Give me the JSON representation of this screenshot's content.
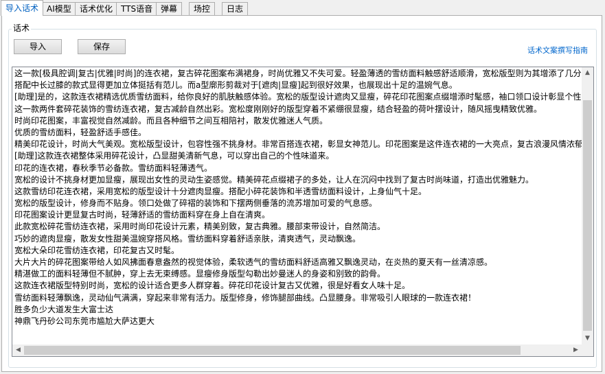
{
  "tabs": [
    {
      "label": "导入话术",
      "active": true
    },
    {
      "label": "AI模型"
    },
    {
      "label": "话术优化"
    },
    {
      "label": "TTS语音"
    },
    {
      "label": "弹幕"
    },
    {
      "label": "场控"
    },
    {
      "label": "日志"
    }
  ],
  "group": {
    "title": "话术"
  },
  "toolbar": {
    "import_label": "导入",
    "save_label": "保存",
    "guide_link": "话术文案撰写指南"
  },
  "script_lines": [
    "这一款[极具腔调|复古|优雅|时尚]的连衣裙，复古碎花图案布满裙身，时尚优雅又不失可爱。轻盈薄透的雪纺面料触感舒适顺滑，宽松版型则为其增添了几分",
    "搭配中长过膝的款式显得更加立体挺括有范儿。而a型廓形剪裁对于[遮肉|显瘦]起到很好效果，也展现出十足的温婉气息。",
    "[助理]是的，这款连衣裙精选优质雪纺面料，给你良好的肌肤触感体验。宽松的版型设计遮肉又显瘦，碎花印花图案点缀增添时髦感，袖口领口设计彰显个性",
    "这一款两件套碎花装饰的雪纺连衣裙，复古减龄自然出彩。宽松度刚刚好的版型穿着不紧绷很显瘦，结合轻盈的荷叶摆设计，随风摇曳精致优雅。",
    "时尚印花图案，丰富视觉自然减龄。而且各种细节之间互相陪衬，散发优雅迷人气质。",
    "优质的雪纺面料，轻盈舒适手感佳。",
    "精美印花设计，时尚大气美观。宽松版型设计，包容性强不挑身材。非常百搭连衣裙，彰显女神范儿。印花图案是这件连衣裙的一大亮点，复古浪漫风情浓郁",
    "[助理]这款连衣裙整体采用碎花设计，凸显甜美清新气息，可以穿出自己的个性味道来。",
    "印花的连衣裙，春秋季节必备款。雪纺面料轻薄透气。",
    "宽松的设计不挑身材更加显瘦，展现出女性的灵动生姿感觉。精美碎花点缀裙子的多处，让人在沉闷中找到了复古时尚味道，打造出优雅魅力。",
    "这款雪纺印花连衣裙，采用宽松的版型设计十分遮肉显瘦。搭配小碎花装饰和半透雪纺面料设计，上身仙气十足。",
    "宽松的版型设计，修身而不贴身。领口处做了碎褶的装饰和下摆两侧垂落的流苏增加可爱的气息感。",
    "印花图案设计更显复古时尚，轻薄舒适的雪纺面料穿在身上自在清爽。",
    "此款宽松碎花雪纺连衣裙，采用时尚印花设计元素，精美别致，复古典雅。腰部束带设计，自然简洁。",
    "巧妙的遮肉显瘦，散发女性甜美温婉穿搭风格。雪纺面料穿着舒适亲肤，清爽透气，灵动飘逸。",
    "宽松大朵印花雪纺连衣裙，印花复古又时髦。",
    "大片大片的碎花图案带给人如风拂面春意盎然的视觉体验，柔软透气的雪纺面料舒适高雅又飘逸灵动，在炎热的夏天有一丝清凉感。",
    "精湛做工的面料轻薄但不腻肿，穿上去无束缚感。显瘦修身版型勾勒出妙曼迷人的身姿和别致的韵骨。",
    "这款连衣裙版型特别时尚，宽松的设计适合更多人群穿着。碎花印花设计复古又优雅，很是好看女人味十足。",
    "雪纺面料轻薄飘逸，灵动仙气满满，穿起来非常有活力。版型修身，修饰腿部曲线。凸显腰身。非常吸引人眼球的一款连衣裙！",
    "胜多负少大道发生大富士达",
    "神鼎飞丹砂公司东莞市尴尬大萨达更大"
  ],
  "scrollbars": {
    "up_glyph": "▲",
    "down_glyph": "▼",
    "left_glyph": "◀",
    "right_glyph": "▶"
  }
}
